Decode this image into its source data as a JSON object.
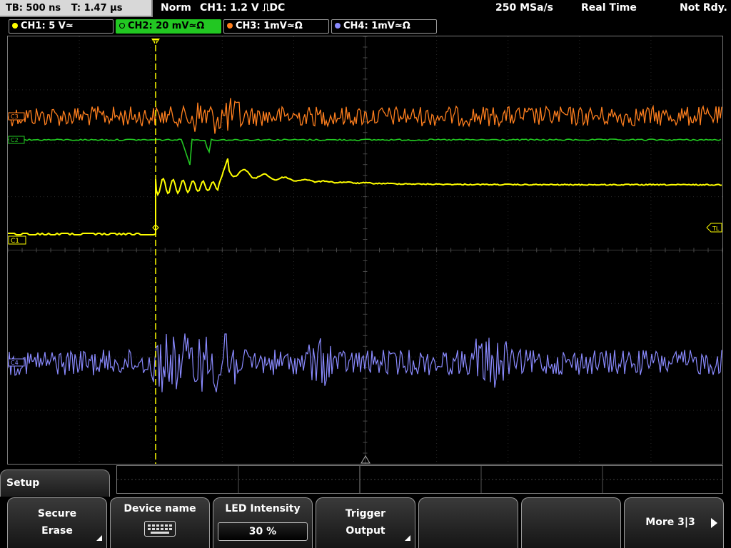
{
  "topbar": {
    "timebase": "TB: 500 ns",
    "trigger_time": "T: 1.47 µs",
    "mode": "Norm",
    "trigger": "CH1: 1.2 V ⎍DC",
    "sample_rate": "250 MSa/s",
    "acq_mode": "Real Time",
    "status": "Not Rdy."
  },
  "channels": [
    {
      "label": "CH1: 5 V≃",
      "color": "#ffff00"
    },
    {
      "label": "CH2: 20 mV≃Ω",
      "color": "#22c722"
    },
    {
      "label": "CH3: 1mV≃Ω",
      "color": "#ff7f1e"
    },
    {
      "label": "CH4: 1mV≃Ω",
      "color": "#8a8aff"
    }
  ],
  "markers": {
    "c1": "C1",
    "c2": "C2",
    "c3": "C3",
    "c4": "C4",
    "trigger_level": "TL",
    "trigger_pos": "T"
  },
  "menu": {
    "title": "Setup",
    "secure_erase_l1": "Secure",
    "secure_erase_l2": "Erase",
    "device_name": "Device name",
    "device_name_icon": "keyboard-icon",
    "led_intensity": "LED Intensity",
    "led_value": "30 %",
    "trigger_output_l1": "Trigger",
    "trigger_output_l2": "Output",
    "more": "More 3|3"
  }
}
